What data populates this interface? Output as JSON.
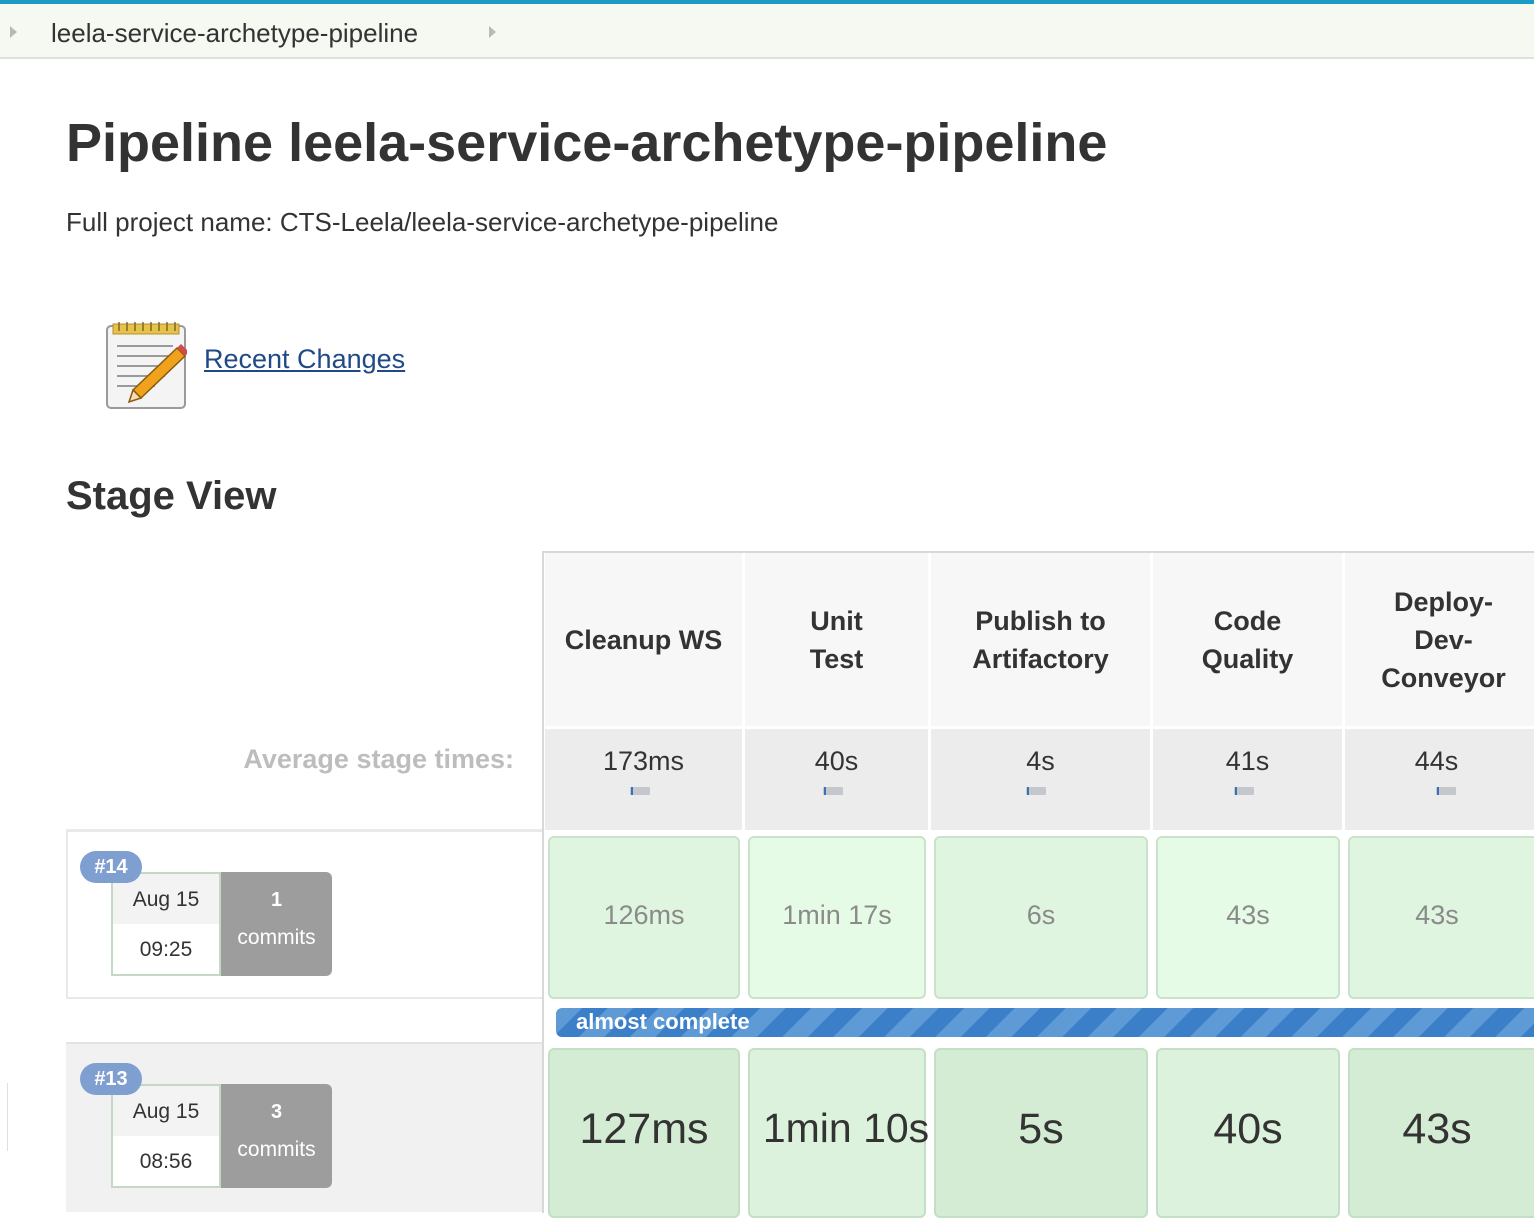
{
  "breadcrumb": {
    "item": "leela-service-archetype-pipeline"
  },
  "page": {
    "title": "Pipeline leela-service-archetype-pipeline",
    "full_name_label": "Full project name:",
    "full_name_value": "CTS-Leela/leela-service-archetype-pipeline"
  },
  "recent_changes": {
    "label": "Recent Changes",
    "icon": "notepad-icon"
  },
  "stage_view": {
    "title": "Stage View",
    "average_label": "Average stage times:",
    "stages": [
      {
        "name": "Cleanup WS",
        "avg": "173ms"
      },
      {
        "name": "Unit Test",
        "avg": "40s"
      },
      {
        "name": "Publish to Artifactory",
        "avg": "4s"
      },
      {
        "name": "Code Quality",
        "avg": "41s"
      },
      {
        "name": "Deploy-Dev-Conveyor",
        "avg": "44s"
      }
    ],
    "runs": [
      {
        "number": "#14",
        "date": "Aug 15",
        "time": "09:25",
        "commits_count": "1",
        "commits_label": "commits",
        "times": [
          "126ms",
          "1min 17s",
          "6s",
          "43s",
          "43s"
        ],
        "status_text": "almost complete",
        "status_color": "#3a7fc8"
      },
      {
        "number": "#13",
        "date": "Aug 15",
        "time": "08:56",
        "commits_count": "3",
        "commits_label": "commits",
        "times": [
          "127ms",
          "1min 10s",
          "5s",
          "40s",
          "43s"
        ]
      }
    ]
  },
  "colors": {
    "accent": "#1a9bc4",
    "success_cell": "#dff5df",
    "badge": "#7f9fd1",
    "link": "#204a87"
  }
}
